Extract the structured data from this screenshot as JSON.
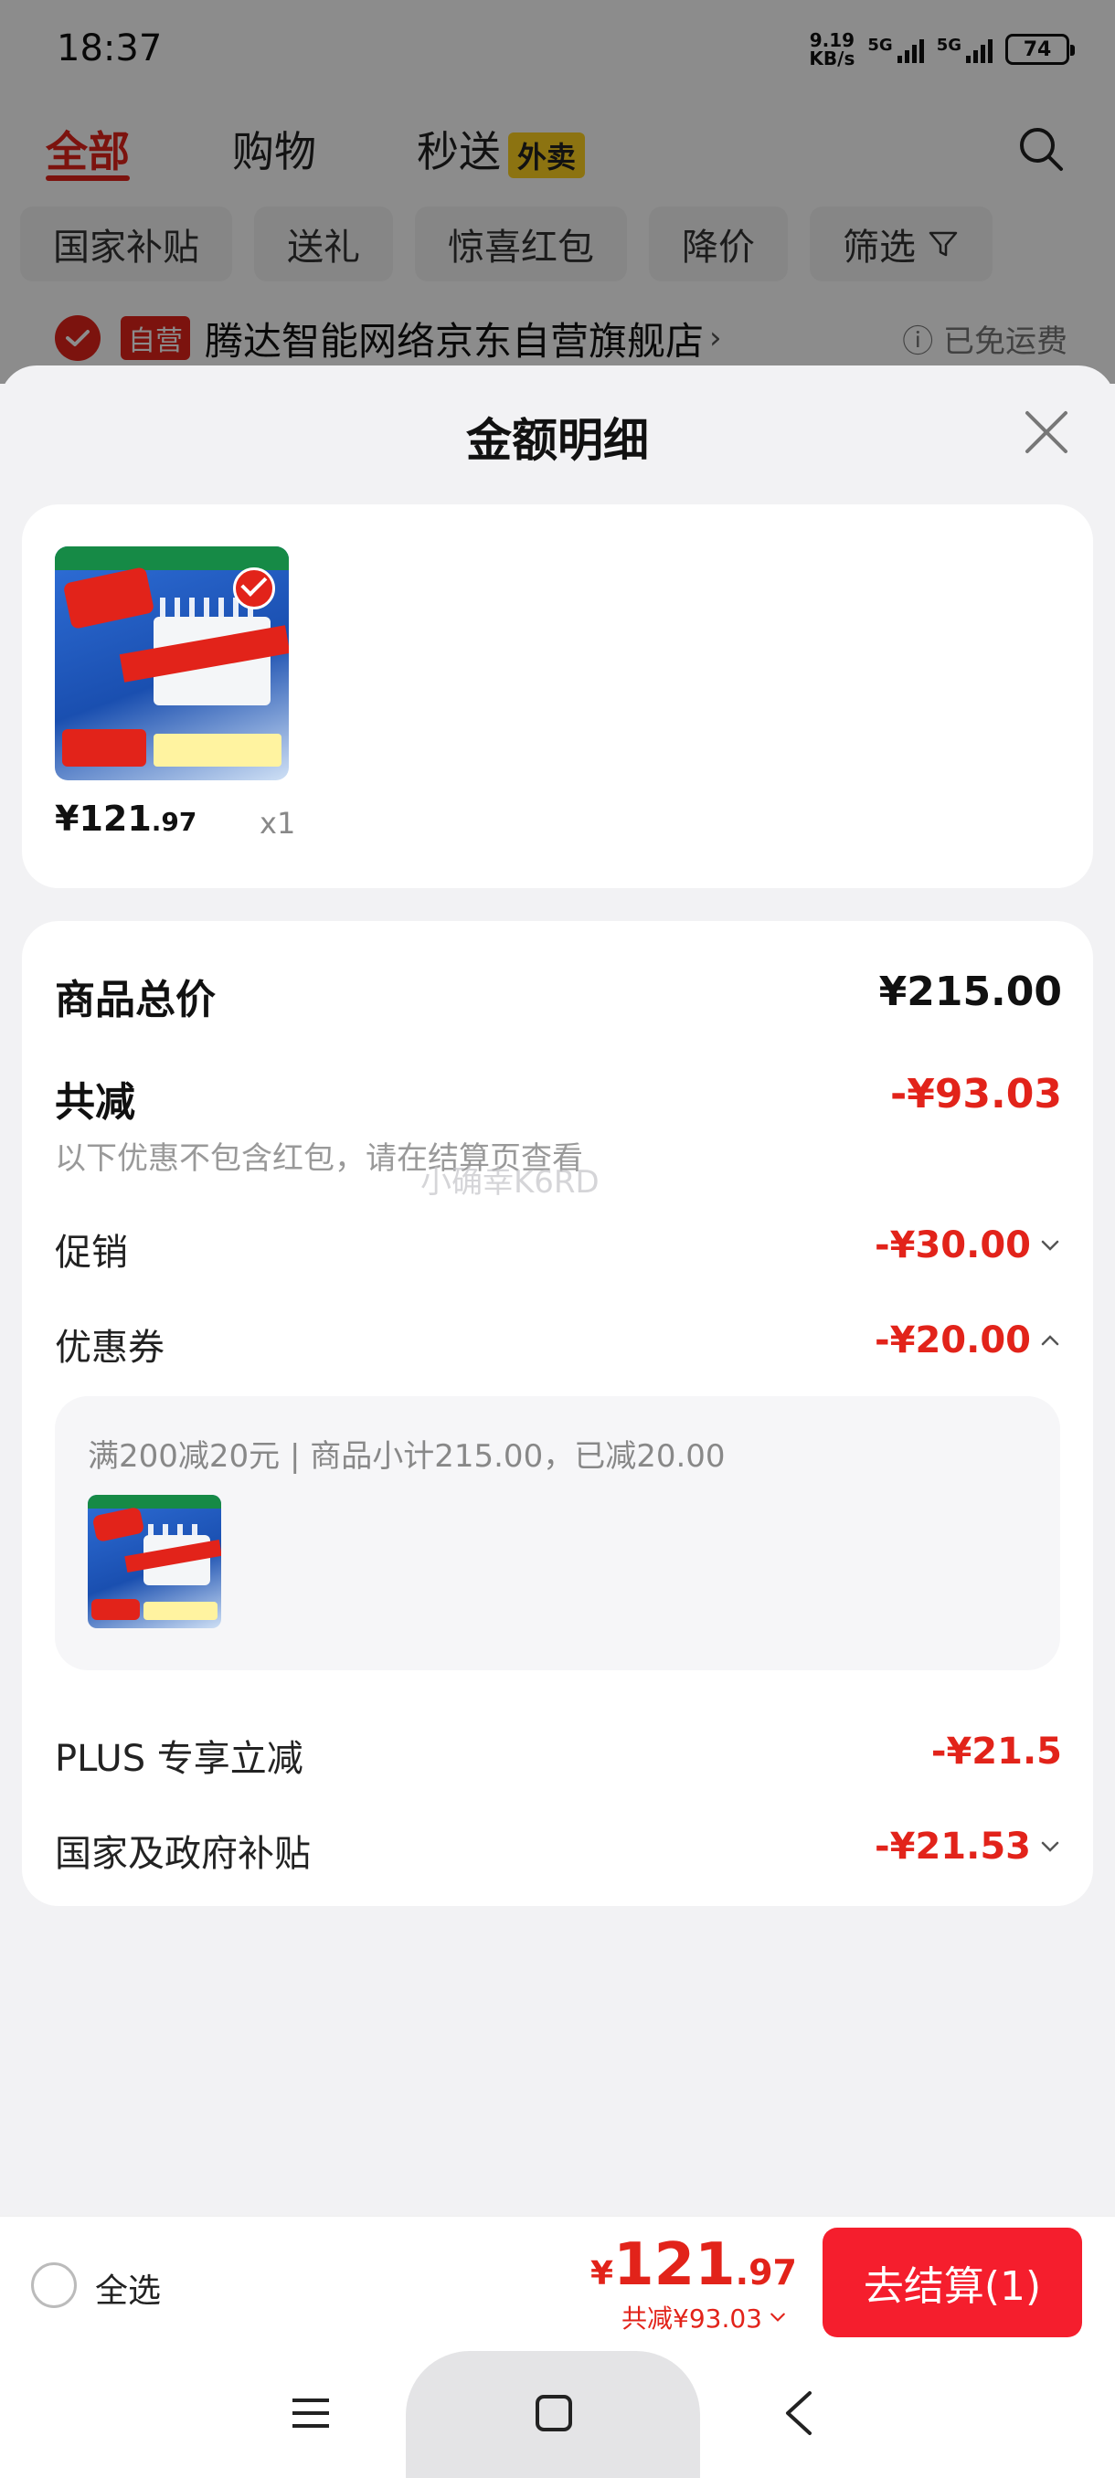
{
  "status_bar": {
    "time": "18:37",
    "net_speed_value": "9.19",
    "net_speed_unit": "KB/s",
    "sim1": "5G",
    "sim2": "5G",
    "battery": "74"
  },
  "top_nav": {
    "tabs": [
      {
        "label": "全部",
        "active": true
      },
      {
        "label": "购物",
        "active": false
      },
      {
        "label": "秒送",
        "active": false
      }
    ],
    "waimai_badge": "外卖",
    "icons": {
      "search": "search-icon"
    }
  },
  "filter_chips": [
    "国家补贴",
    "送礼",
    "惊喜红包",
    "降价",
    "筛选"
  ],
  "shop": {
    "badge": "自营",
    "name": "腾达智能网络京东自营旗舰店",
    "arrow": "›",
    "shipping": "ⓘ 已免运费"
  },
  "sheet": {
    "title": "金额明细",
    "item": {
      "price_yen": "¥121",
      "price_dec": ".97",
      "qty": "x1"
    },
    "summary": {
      "total_label": "商品总价",
      "total_value": "¥215.00",
      "reduce_label": "共减",
      "reduce_value": "-¥93.03",
      "hint": "以下优惠不包含红包，请在结算页查看",
      "watermark": "小确幸K6RD"
    },
    "rows": [
      {
        "label": "促销",
        "value": "-¥30.00",
        "expanded": false
      },
      {
        "label": "优惠券",
        "value": "-¥20.00",
        "expanded": true
      },
      {
        "label": "PLUS 专享立减",
        "value": "-¥21.5"
      },
      {
        "label": "国家及政府补贴",
        "value": "-¥21.53",
        "expanded": false
      }
    ],
    "coupon_detail": "满200减20元 | 商品小计215.00，已减20.00"
  },
  "bottom_bar": {
    "select_all": "全选",
    "total_cur": "¥",
    "total_int": "121",
    "total_dec": ".97",
    "total_reduce": "共减¥93.03",
    "checkout": "去结算(1)"
  },
  "colors": {
    "accent": "#e2231a",
    "checkout_button": "#f51e2d",
    "waimai": "#ffd21f"
  }
}
